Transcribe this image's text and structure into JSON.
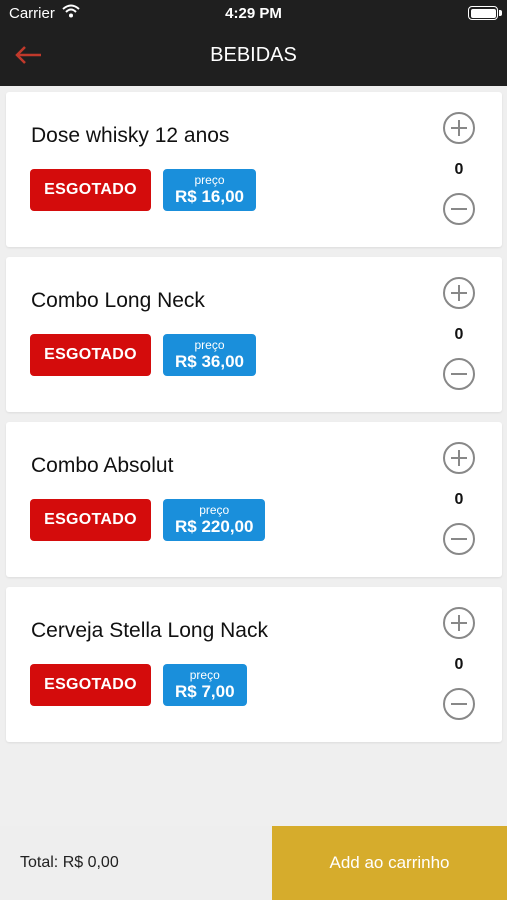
{
  "status_bar": {
    "carrier": "Carrier",
    "time": "4:29 PM"
  },
  "header": {
    "title": "BEBIDAS",
    "back_icon": "arrow-left-icon",
    "accent_color": "#c0392b"
  },
  "items": [
    {
      "name": "Dose whisky 12 anos",
      "status": "ESGOTADO",
      "price_label": "preço",
      "price": "R$ 16,00",
      "quantity": "0"
    },
    {
      "name": "Combo Long Neck",
      "status": "ESGOTADO",
      "price_label": "preço",
      "price": "R$ 36,00",
      "quantity": "0"
    },
    {
      "name": "Combo Absolut",
      "status": "ESGOTADO",
      "price_label": "preço",
      "price": "R$ 220,00",
      "quantity": "0"
    },
    {
      "name": "Cerveja Stella Long Nack",
      "status": "ESGOTADO",
      "price_label": "preço",
      "price": "R$ 7,00",
      "quantity": "0"
    }
  ],
  "footer": {
    "total": "Total: R$ 0,00",
    "add_to_cart": "Add ao carrinho"
  },
  "colors": {
    "sold_out": "#d40c0c",
    "price": "#1a8fdb",
    "cart_button": "#d6ac2c",
    "header_bg": "#1f1f1f"
  }
}
